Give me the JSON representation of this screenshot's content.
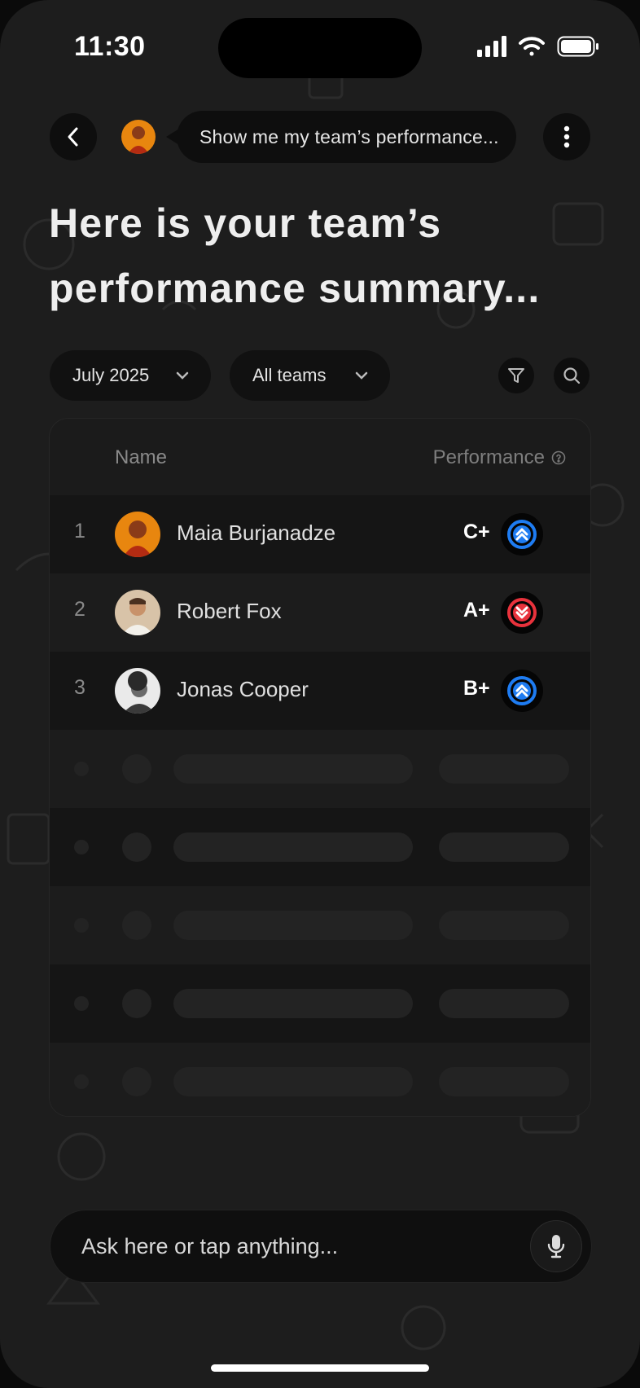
{
  "status": {
    "time": "11:30"
  },
  "header": {
    "prompt": "Show me my team’s performance..."
  },
  "title": "Here is your team’s performance summary...",
  "filters": {
    "month": "July 2025",
    "team": "All teams"
  },
  "table": {
    "headers": {
      "name": "Name",
      "performance": "Performance"
    },
    "rows": [
      {
        "rank": "1",
        "name": "Maia Burjanadze",
        "grade": "C+",
        "trend": "up"
      },
      {
        "rank": "2",
        "name": "Robert Fox",
        "grade": "A+",
        "trend": "down"
      },
      {
        "rank": "3",
        "name": "Jonas Cooper",
        "grade": "B+",
        "trend": "up"
      }
    ]
  },
  "input": {
    "placeholder": "Ask here or tap anything..."
  },
  "colors": {
    "trend_up": "#1e7cf2",
    "trend_down": "#e8323c",
    "avatar_orange": "#e8860f"
  }
}
